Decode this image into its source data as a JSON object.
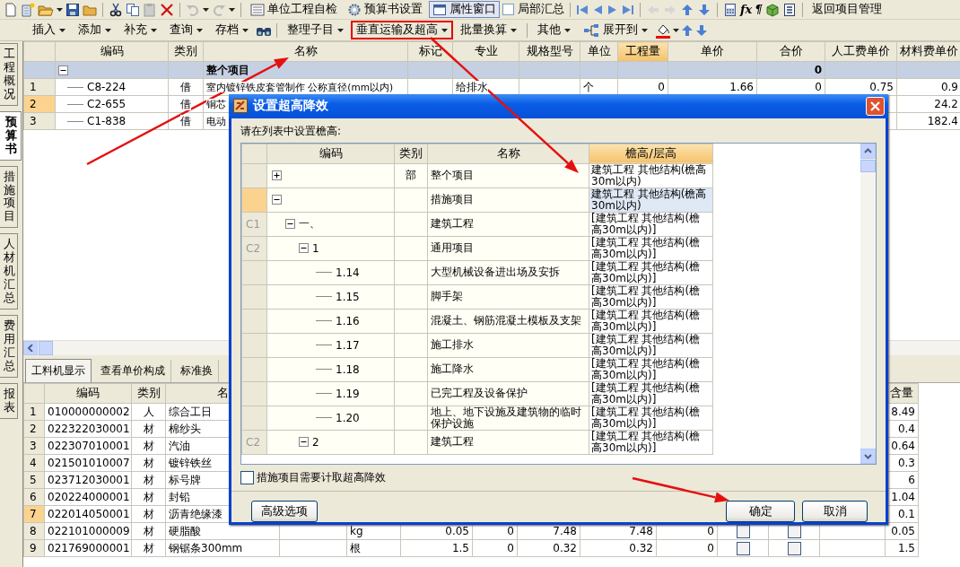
{
  "toolbar": {
    "buttons": [
      {
        "label": "单位工程自检",
        "pressed": false
      },
      {
        "label": "预算书设置",
        "pressed": false
      },
      {
        "label": "属性窗口",
        "pressed": true
      }
    ],
    "summary_checkbox": {
      "label": "局部汇总",
      "checked": false
    },
    "glyphs": [
      "fx",
      "¶"
    ],
    "return_button": "返回项目管理"
  },
  "edit_toolbar": {
    "groups": [
      [
        {
          "label": "插入",
          "highlighted": false
        },
        {
          "label": "添加",
          "highlighted": false
        },
        {
          "label": "补充",
          "highlighted": false
        },
        {
          "label": "查询",
          "highlighted": false
        },
        {
          "label": "存档",
          "highlighted": false
        }
      ],
      [
        {
          "label": "整理子目",
          "highlighted": false
        },
        {
          "label": "垂直运输及超高",
          "highlighted": true
        },
        {
          "label": "批量换算",
          "highlighted": false
        }
      ],
      [
        {
          "label": "其他",
          "highlighted": false
        },
        {
          "label": "展开到",
          "highlighted": false
        }
      ]
    ]
  },
  "side_tabs": [
    {
      "label": "工程概况",
      "selected": false
    },
    {
      "label": "预算书",
      "selected": true
    },
    {
      "label": "措施项目",
      "selected": false
    },
    {
      "label": "人材机汇总",
      "selected": false
    },
    {
      "label": "费用汇总",
      "selected": false
    },
    {
      "label": "报表",
      "selected": false
    }
  ],
  "main_table": {
    "columns": [
      {
        "label": "编码",
        "selected": false
      },
      {
        "label": "类别",
        "selected": false
      },
      {
        "label": "名称",
        "selected": false
      },
      {
        "label": "标记",
        "selected": false
      },
      {
        "label": "专业",
        "selected": false
      },
      {
        "label": "规格型号",
        "selected": false
      },
      {
        "label": "单位",
        "selected": false
      },
      {
        "label": "工程量",
        "selected": true
      },
      {
        "label": "单价",
        "selected": false
      },
      {
        "label": "合价",
        "selected": false
      },
      {
        "label": "人工费单价",
        "selected": false
      },
      {
        "label": "材料费单价",
        "selected": false
      }
    ],
    "group_row": {
      "expanded": true,
      "name": "整个项目",
      "total": "0"
    },
    "rows": [
      {
        "num": "1",
        "code": "C8-224",
        "type": "借",
        "name": "室内镀锌铁皮套管制作 公称直径(mm以内)",
        "specialty": "给排水",
        "unit": "个",
        "quantity": "0",
        "unit_price": "1.66",
        "total": "0",
        "labor_price": "0.75",
        "material_price": "0.9",
        "selected": false
      },
      {
        "num": "2",
        "code": "C2-655",
        "type": "借",
        "name": "铜芯",
        "material_price": "24.2",
        "selected": true
      },
      {
        "num": "3",
        "code": "C1-838",
        "type": "借",
        "name": "电动",
        "material_price": "182.4",
        "selected": false
      }
    ]
  },
  "detail_tabs": [
    {
      "label": "工料机显示",
      "selected": true
    },
    {
      "label": "查看单价构成",
      "selected": false
    },
    {
      "label": "标准换",
      "selected": false
    }
  ],
  "detail_table": {
    "columns": [
      {
        "label": "编码"
      },
      {
        "label": "类别"
      },
      {
        "label": "名"
      },
      {},
      {},
      {},
      {},
      {},
      {},
      {},
      {},
      {},
      {},
      {
        "label": "含量"
      }
    ],
    "rows": [
      {
        "num": "1",
        "code": "010000000002",
        "type": "人",
        "name": "综合工日",
        "amount": "8.49",
        "selected": false
      },
      {
        "num": "2",
        "code": "022322030001",
        "type": "材",
        "name": "棉纱头",
        "amount": "0.4",
        "selected": false
      },
      {
        "num": "3",
        "code": "022307010001",
        "type": "材",
        "name": "汽油",
        "amount": "0.64",
        "selected": false
      },
      {
        "num": "4",
        "code": "021501010007",
        "type": "材",
        "name": "镀锌铁丝",
        "amount": "0.3",
        "selected": false
      },
      {
        "num": "5",
        "code": "023712030001",
        "type": "材",
        "name": "标号牌",
        "amount": "6",
        "selected": false
      },
      {
        "num": "6",
        "code": "020224000001",
        "type": "材",
        "name": "封铅",
        "amount": "1.04",
        "selected": false
      },
      {
        "num": "7",
        "code": "022014050001",
        "type": "材",
        "name": "沥青绝缘漆",
        "amount": "0.1",
        "selected": true
      },
      {
        "num": "8",
        "code": "022101000009",
        "type": "材",
        "name": "硬脂酸",
        "unit": "kg",
        "column_6": "0.05",
        "column_7": "0",
        "column_8": "7.48",
        "column_9": "7.48",
        "column_10": "0",
        "checks": [
          false,
          false
        ],
        "amount": "0.05",
        "selected": false
      },
      {
        "num": "9",
        "code": "021769000001",
        "type": "材",
        "name": "钢锯条300mm",
        "unit": "根",
        "column_6": "1.5",
        "column_7": "0",
        "column_8": "0.32",
        "column_9": "0.32",
        "column_10": "0",
        "checks": [
          false,
          false
        ],
        "amount": "1.5",
        "selected": false
      }
    ]
  },
  "dialog": {
    "title": "设置超高降效",
    "prompt": "请在列表中设置檐高:",
    "columns": [
      "编码",
      "类别",
      "名称",
      "檐高/层高"
    ],
    "tree": [
      {
        "type": "部",
        "name": "整个项目",
        "height": "建筑工程 其他结构(檐高30m以内)",
        "expanded": false,
        "selected": false
      },
      {
        "name": "措施项目",
        "height": "建筑工程 其他结构(檐高30m以内)",
        "expanded": true,
        "selected": true,
        "children": [
          {
            "row_label": "C1",
            "code": "一、",
            "name": "建筑工程",
            "height": "[建筑工程 其他结构(檐高30m以内)]",
            "expanded": true,
            "selected": false,
            "children": [
              {
                "row_label": "C2",
                "code": "1",
                "name": "通用项目",
                "height": "[建筑工程 其他结构(檐高30m以内)]",
                "expanded": true,
                "selected": false,
                "children": [
                  {
                    "code": "1.14",
                    "name": "大型机械设备进出场及安拆",
                    "height": "[建筑工程 其他结构(檐高30m以内)]",
                    "selected": false
                  },
                  {
                    "code": "1.15",
                    "name": "脚手架",
                    "height": "[建筑工程 其他结构(檐高30m以内)]",
                    "selected": false
                  },
                  {
                    "code": "1.16",
                    "name": "混凝土、钢筋混凝土模板及支架",
                    "height": "[建筑工程 其他结构(檐高30m以内)]",
                    "selected": false
                  },
                  {
                    "code": "1.17",
                    "name": "施工排水",
                    "height": "[建筑工程 其他结构(檐高30m以内)]",
                    "selected": false
                  },
                  {
                    "code": "1.18",
                    "name": "施工降水",
                    "height": "[建筑工程 其他结构(檐高30m以内)]",
                    "selected": false
                  },
                  {
                    "code": "1.19",
                    "name": "已完工程及设备保护",
                    "height": "[建筑工程 其他结构(檐高30m以内)]",
                    "selected": false
                  },
                  {
                    "code": "1.20",
                    "name": "地上、地下设施及建筑物的临时保护设施",
                    "height": "[建筑工程 其他结构(檐高30m以内)]",
                    "selected": false
                  }
                ]
              },
              {
                "row_label": "C2",
                "code": "2",
                "name": "建筑工程",
                "height": "[建筑工程 其他结构(檐高30m以内)]",
                "expanded": true,
                "selected": false
              }
            ]
          }
        ]
      }
    ],
    "checkbox": {
      "label": "措施项目需要计取超高降效",
      "checked": false
    },
    "buttons": {
      "advanced": "高级选项",
      "ok": "确定",
      "cancel": "取消"
    }
  }
}
